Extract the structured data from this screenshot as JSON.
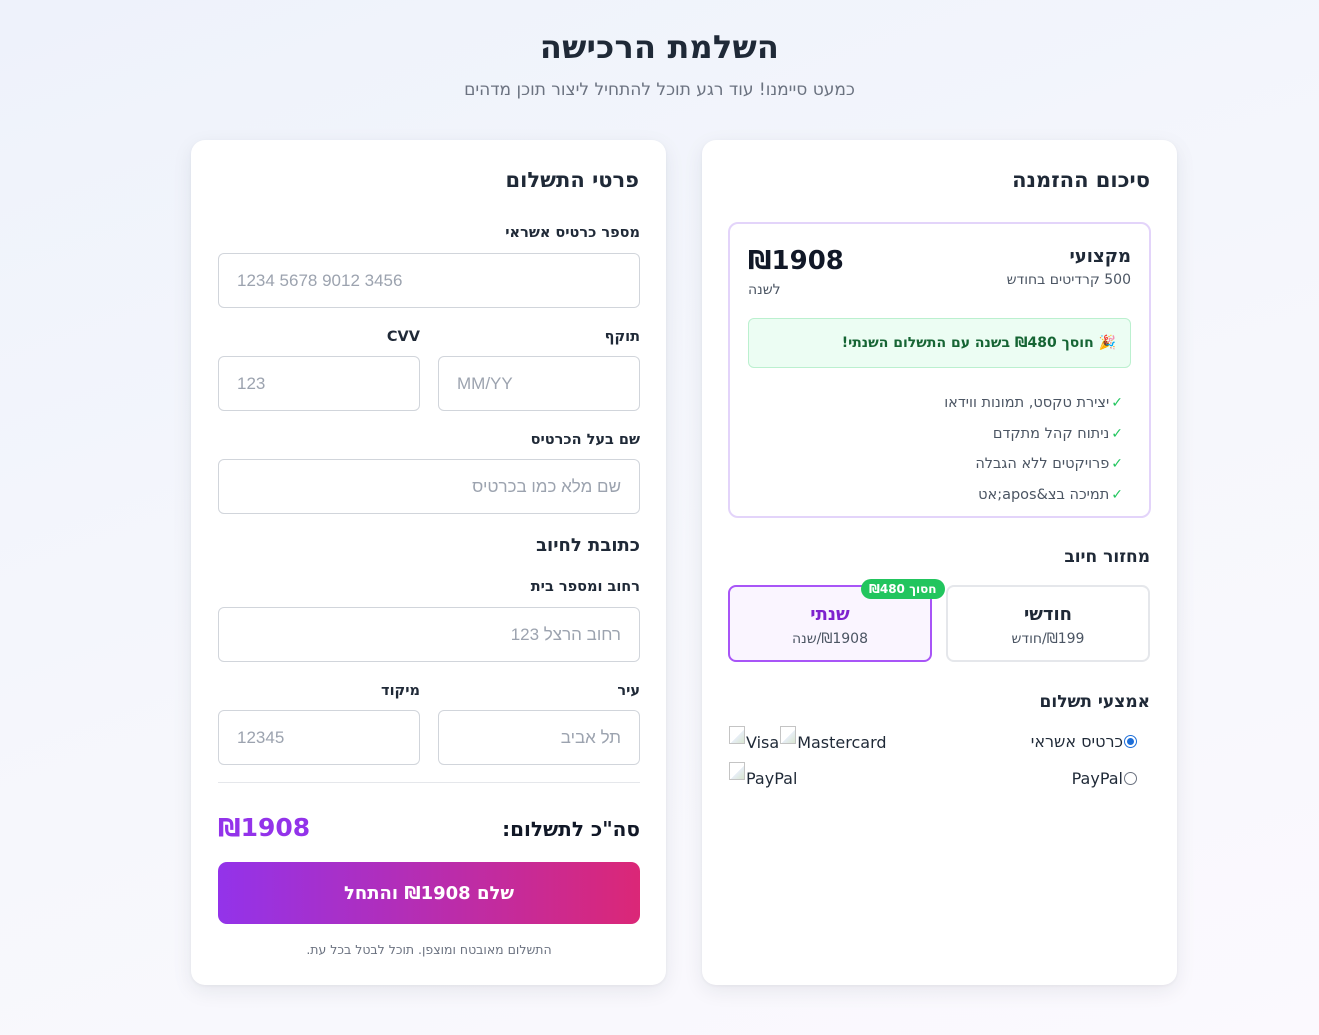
{
  "header": {
    "title": "השלמת הרכישה",
    "subtitle": "כמעט סיימנו! עוד רגע תוכל להתחיל ליצור תוכן מדהים"
  },
  "summary": {
    "title": "סיכום ההזמנה",
    "plan": {
      "name": "מקצועי",
      "credits": "500 קרדיטים בחודש",
      "price": "₪1908",
      "period": "לשנה",
      "savings": "🎉 חוסך ₪480 בשנה עם התשלום השנתי!",
      "features": [
        "יצירת טקסט, תמונות ווידאו",
        "ניתוח קהל מתקדם",
        "פרויקטים ללא הגבלה",
        "תמיכה בצ&apos;אט"
      ],
      "check_glyph": "✓"
    },
    "billing_cycle": {
      "label": "מחזור חיוב",
      "monthly": {
        "name": "חודשי",
        "price": "₪199/חודש"
      },
      "yearly": {
        "name": "שנתי",
        "price": "₪1908/שנה",
        "badge": "חסוך ₪480"
      },
      "selected": "yearly"
    },
    "payment_methods": {
      "label": "אמצעי תשלום",
      "options": [
        {
          "label": "כרטיס אשראי",
          "checked": true,
          "logos": [
            "Visa",
            "Mastercard"
          ]
        },
        {
          "label": "PayPal",
          "checked": false,
          "logos": [
            "PayPal"
          ]
        }
      ]
    }
  },
  "payment": {
    "title": "פרטי התשלום",
    "card_number": {
      "label": "מספר כרטיס אשראי",
      "placeholder": "1234 5678 9012 3456",
      "value": ""
    },
    "expiry": {
      "label": "תוקף",
      "placeholder": "MM/YY",
      "value": ""
    },
    "cvv": {
      "label": "CVV",
      "placeholder": "123",
      "value": ""
    },
    "cardholder": {
      "label": "שם בעל הכרטיס",
      "placeholder": "שם מלא כמו בכרטיס",
      "value": ""
    },
    "billing_address_heading": "כתובת לחיוב",
    "street": {
      "label": "רחוב ומספר בית",
      "placeholder": "רחוב הרצל 123",
      "value": ""
    },
    "city": {
      "label": "עיר",
      "placeholder": "תל אביב",
      "value": ""
    },
    "zip": {
      "label": "מיקוד",
      "placeholder": "12345",
      "value": ""
    },
    "total_label": "סה\"כ לתשלום:",
    "total_value": "₪1908",
    "pay_button": "שלם ₪1908 והתחל",
    "secure_note": "התשלום מאובטח ומוצפן. תוכל לבטל בכל עת."
  },
  "colors": {
    "accent_purple": "#9333ea",
    "accent_pink": "#db2777",
    "success_green": "#22c55e"
  }
}
